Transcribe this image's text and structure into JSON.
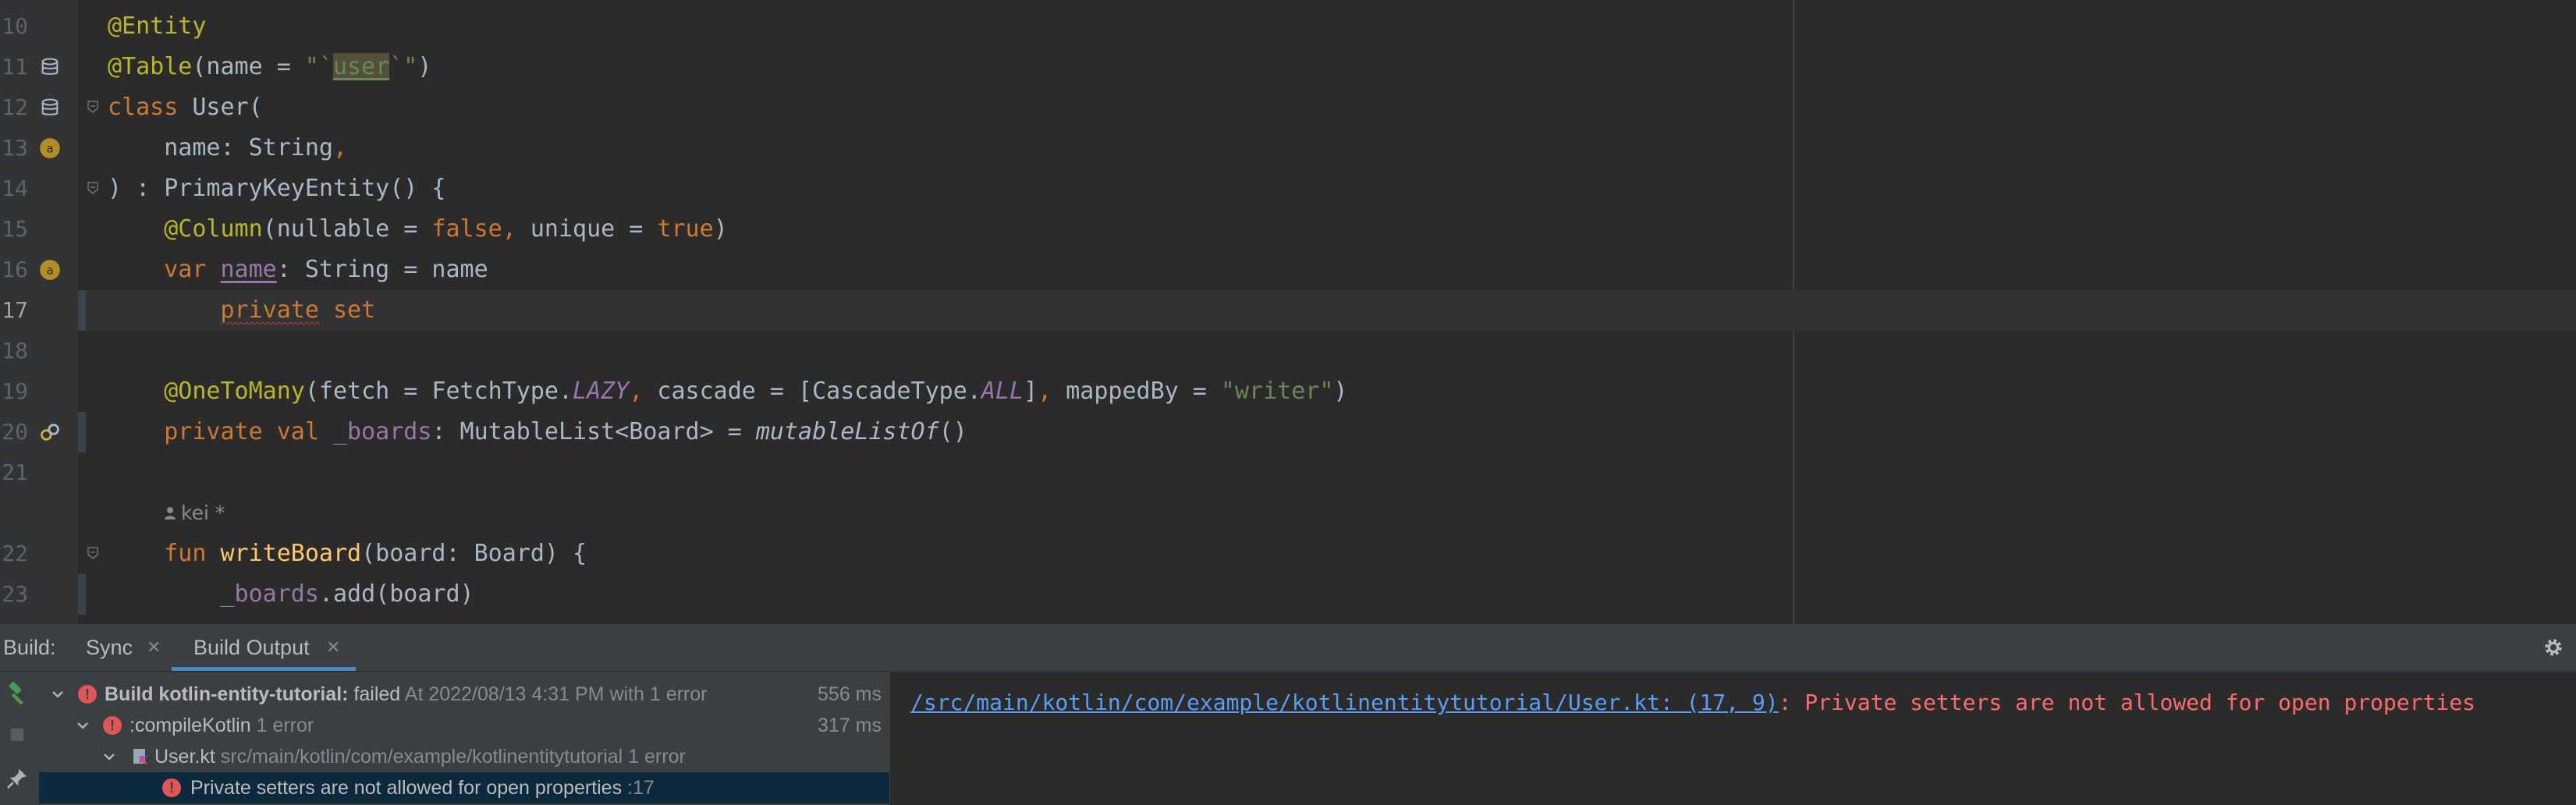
{
  "editor": {
    "lines": [
      {
        "num": "10",
        "tokens": [
          {
            "t": "@Entity",
            "c": "an"
          }
        ]
      },
      {
        "num": "11",
        "tokens": [
          {
            "t": "@Table",
            "c": "an"
          },
          {
            "t": "(name = "
          },
          {
            "t": "\"`",
            "c": "str"
          },
          {
            "t": "user",
            "c": "str hl ul"
          },
          {
            "t": "`\"",
            "c": "str"
          },
          {
            "t": ")"
          }
        ],
        "gutter_icon": "database-table-icon"
      },
      {
        "num": "12",
        "tokens": [
          {
            "t": "class ",
            "c": "kw"
          },
          {
            "t": "User("
          }
        ],
        "gutter_icon": "database-table-icon",
        "fold": true
      },
      {
        "num": "13",
        "tokens": [
          {
            "t": "    name: String"
          },
          {
            "t": ",",
            "c": "kw"
          }
        ],
        "gutter_icon": "annotation-marker-icon"
      },
      {
        "num": "14",
        "tokens": [
          {
            "t": ") : PrimaryKeyEntity() {"
          }
        ],
        "fold": true
      },
      {
        "num": "15",
        "tokens": [
          {
            "t": "    "
          },
          {
            "t": "@Column",
            "c": "an"
          },
          {
            "t": "(nullable = "
          },
          {
            "t": "false",
            "c": "kw"
          },
          {
            "t": ", ",
            "c": "kw"
          },
          {
            "t": "unique = "
          },
          {
            "t": "true",
            "c": "kw"
          },
          {
            "t": ")"
          }
        ]
      },
      {
        "num": "16",
        "tokens": [
          {
            "t": "    "
          },
          {
            "t": "var ",
            "c": "kw"
          },
          {
            "t": "name",
            "c": "prop ul"
          },
          {
            "t": ": String = name"
          }
        ],
        "gutter_icon": "annotation-marker-icon"
      },
      {
        "num": "17",
        "tokens": [
          {
            "t": "        "
          },
          {
            "t": "private",
            "c": "kw sq"
          },
          {
            "t": " set",
            "c": "kw"
          }
        ],
        "current": true
      },
      {
        "num": "18",
        "tokens": []
      },
      {
        "num": "19",
        "tokens": [
          {
            "t": "    "
          },
          {
            "t": "@OneToMany",
            "c": "an"
          },
          {
            "t": "(fetch = FetchType."
          },
          {
            "t": "LAZY",
            "c": "prop it"
          },
          {
            "t": ", ",
            "c": "kw"
          },
          {
            "t": "cascade = [CascadeType."
          },
          {
            "t": "ALL",
            "c": "prop it"
          },
          {
            "t": "]"
          },
          {
            "t": ", ",
            "c": "kw"
          },
          {
            "t": "mappedBy = "
          },
          {
            "t": "\"writer\"",
            "c": "str"
          },
          {
            "t": ")"
          }
        ]
      },
      {
        "num": "20",
        "tokens": [
          {
            "t": "    "
          },
          {
            "t": "private val ",
            "c": "kw"
          },
          {
            "t": "_boards",
            "c": "prop"
          },
          {
            "t": ": MutableList<Board> = "
          },
          {
            "t": "mutableListOf",
            "c": "it"
          },
          {
            "t": "()"
          }
        ],
        "gutter_icon": "relationship-link-icon"
      },
      {
        "num": "21",
        "tokens": []
      },
      {
        "num": "",
        "tokens": [],
        "hint": "kei *"
      },
      {
        "num": "22",
        "tokens": [
          {
            "t": "    "
          },
          {
            "t": "fun ",
            "c": "kw"
          },
          {
            "t": "writeBoard",
            "c": "fn"
          },
          {
            "t": "(board: Board) {"
          }
        ],
        "fold": true
      },
      {
        "num": "23",
        "tokens": [
          {
            "t": "        "
          },
          {
            "t": "_boards",
            "c": "prop"
          },
          {
            "t": ".add(board)"
          }
        ]
      }
    ]
  },
  "build": {
    "label": "Build:",
    "tabs": [
      {
        "label": "Sync"
      },
      {
        "label": "Build Output"
      }
    ],
    "tree": {
      "root": {
        "name": "Build kotlin-entity-tutorial:",
        "status": "failed",
        "detail": "At 2022/08/13 4:31 PM with 1 error",
        "duration": "556 ms"
      },
      "task": {
        "name": ":compileKotlin",
        "detail": "1 error",
        "duration": "317 ms"
      },
      "file": {
        "name": "User.kt",
        "detail": "src/main/kotlin/com/example/kotlinentitytutorial 1 error"
      },
      "error": {
        "message": "Private setters are not allowed for open properties",
        "line": ":17"
      }
    },
    "console": {
      "link": "/src/main/kotlin/com/example/kotlinentitytutorial/User.kt: (17, 9)",
      "message": ": Private setters are not allowed for open properties"
    }
  },
  "colors": {
    "error": "#e05555",
    "link": "#589df6",
    "selection": "#0d293e",
    "accent": "#4a88c7"
  }
}
